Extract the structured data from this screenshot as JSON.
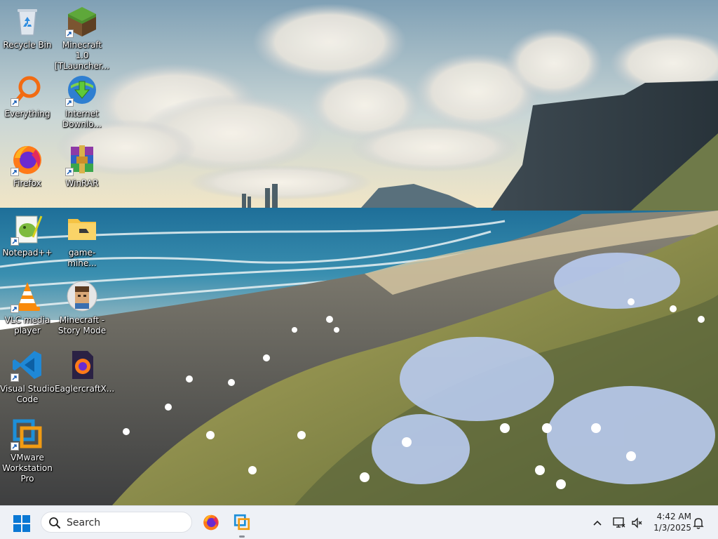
{
  "desktop": {
    "icons": [
      {
        "label": "Recycle Bin",
        "icon": "recycle-bin-icon"
      },
      {
        "label": "Minecraft 1.0 [TLauncher...",
        "icon": "minecraft-block-icon"
      },
      {
        "label": "Everything",
        "icon": "magnifier-icon"
      },
      {
        "label": "Internet Downlo...",
        "icon": "internet-download-manager-icon"
      },
      {
        "label": "Firefox",
        "icon": "firefox-icon"
      },
      {
        "label": "WinRAR",
        "icon": "winrar-icon"
      },
      {
        "label": "Notepad++",
        "icon": "notepad-plus-plus-icon"
      },
      {
        "label": "game-mine...",
        "icon": "folder-icon"
      },
      {
        "label": "VLC media player",
        "icon": "vlc-cone-icon"
      },
      {
        "label": "Minecraft - Story Mode",
        "icon": "minecraft-story-mode-icon"
      },
      {
        "label": "Visual Studio Code",
        "icon": "vscode-icon"
      },
      {
        "label": "EaglercraftX...",
        "icon": "firefox-document-icon"
      },
      {
        "label": "VMware Workstation Pro",
        "icon": "vmware-icon"
      }
    ]
  },
  "taskbar": {
    "search_placeholder": "Search",
    "pinned": [
      "firefox-icon",
      "vmware-icon"
    ],
    "tray": {
      "time": "4:42 AM",
      "date": "1/3/2025"
    }
  },
  "colors": {
    "taskbar_bg": "#eef1f6",
    "windows_blue": "#0a78d4"
  }
}
